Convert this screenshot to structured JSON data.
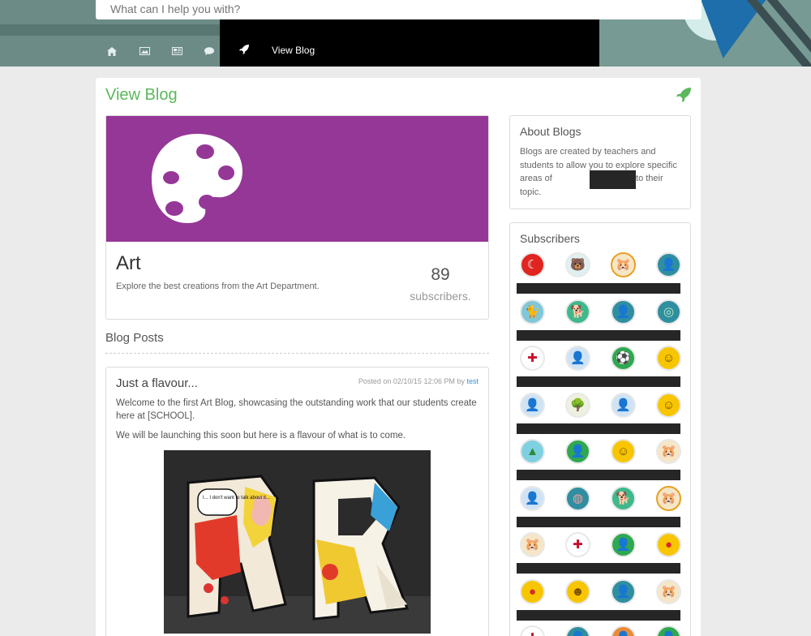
{
  "search": {
    "placeholder": "What can I help you with?"
  },
  "nav": {
    "icons": [
      "home-icon",
      "image-icon",
      "newspaper-icon",
      "comment-icon"
    ],
    "active_label": "View Blog"
  },
  "page": {
    "title": "View Blog"
  },
  "blog": {
    "name": "Art",
    "description": "Explore the best creations from the Art Department.",
    "subscriber_count": "89",
    "subscriber_label": "subscribers."
  },
  "posts_heading": "Blog Posts",
  "post": {
    "title": "Just a flavour...",
    "meta_prefix": "Posted on 02/10/15 12:06 PM by",
    "author": "test",
    "paragraph1": "Welcome to the first Art Blog, showcasing the outstanding work that our students create here at [SCHOOL].",
    "paragraph2": "We will be launching this soon but here is a flavour of what is to come.",
    "image_text": "I... I don't want to talk about it..."
  },
  "about": {
    "title": "About Blogs",
    "text_before": "Blogs are created by teachers and students to allow you to explore specific areas of",
    "text_after": "relating to their topic."
  },
  "subscribers": {
    "title": "Subscribers",
    "rows": [
      [
        {
          "icon": "turkey-flag-icon",
          "bg": "#e0241f"
        },
        {
          "icon": "polar-bear-icon",
          "bg": "#dff0f2"
        },
        {
          "icon": "hamster-icon",
          "bg": "#f5e6c8"
        },
        {
          "icon": "person-dark-icon",
          "bg": "#2f8fa0"
        }
      ],
      [
        {
          "icon": "cat-icon",
          "bg": "#7fc7d9"
        },
        {
          "icon": "dog-icon",
          "bg": "#3fb88c"
        },
        {
          "icon": "man-avatar-icon",
          "bg": "#2f8fa0"
        },
        {
          "icon": "globe-icon",
          "bg": "#2f8fa0"
        }
      ],
      [
        {
          "icon": "uk-flag-icon",
          "bg": "#ffffff"
        },
        {
          "icon": "default-user-icon",
          "bg": "#cfe3f5"
        },
        {
          "icon": "football-icon",
          "bg": "#2fa84f"
        },
        {
          "icon": "smiley-icon",
          "bg": "#f7c600"
        }
      ],
      [
        {
          "icon": "default-user-icon",
          "bg": "#cfe3f5"
        },
        {
          "icon": "tree-icon",
          "bg": "#eef0e0"
        },
        {
          "icon": "default-user-icon",
          "bg": "#cfe3f5"
        },
        {
          "icon": "smiley-icon",
          "bg": "#f7c600"
        }
      ],
      [
        {
          "icon": "mountains-icon",
          "bg": "#7fd0e0"
        },
        {
          "icon": "man-beard-icon",
          "bg": "#2fa84f"
        },
        {
          "icon": "smiley-icon",
          "bg": "#f7c600"
        },
        {
          "icon": "hamster-icon",
          "bg": "#f5e6c8"
        }
      ],
      [
        {
          "icon": "default-user-icon",
          "bg": "#cfe3f5"
        },
        {
          "icon": "brain-icon",
          "bg": "#2f8fa0"
        },
        {
          "icon": "dog-icon",
          "bg": "#3fb88c"
        },
        {
          "icon": "hamster-icon",
          "bg": "#f5e6c8"
        }
      ],
      [
        {
          "icon": "hamster-icon",
          "bg": "#f5e6c8"
        },
        {
          "icon": "uk-flag-icon",
          "bg": "#ffffff"
        },
        {
          "icon": "man-beard-icon",
          "bg": "#2fa84f"
        },
        {
          "icon": "red-ball-icon",
          "bg": "#f7c600"
        }
      ],
      [
        {
          "icon": "red-ball-icon",
          "bg": "#f7c600"
        },
        {
          "icon": "laughing-face-icon",
          "bg": "#f7c600"
        },
        {
          "icon": "man-avatar-icon",
          "bg": "#2f8fa0"
        },
        {
          "icon": "hamster-icon",
          "bg": "#f5e6c8"
        }
      ],
      [
        {
          "icon": "uk-flag-icon",
          "bg": "#ffffff"
        },
        {
          "icon": "man-avatar-icon",
          "bg": "#2f8fa0"
        },
        {
          "icon": "orange-avatar-icon",
          "bg": "#e88b3a"
        },
        {
          "icon": "green-avatar-icon",
          "bg": "#2fa84f"
        }
      ]
    ]
  },
  "colors": {
    "accent": "#5cb85c",
    "banner": "#953797",
    "link": "#3a8fd6"
  }
}
